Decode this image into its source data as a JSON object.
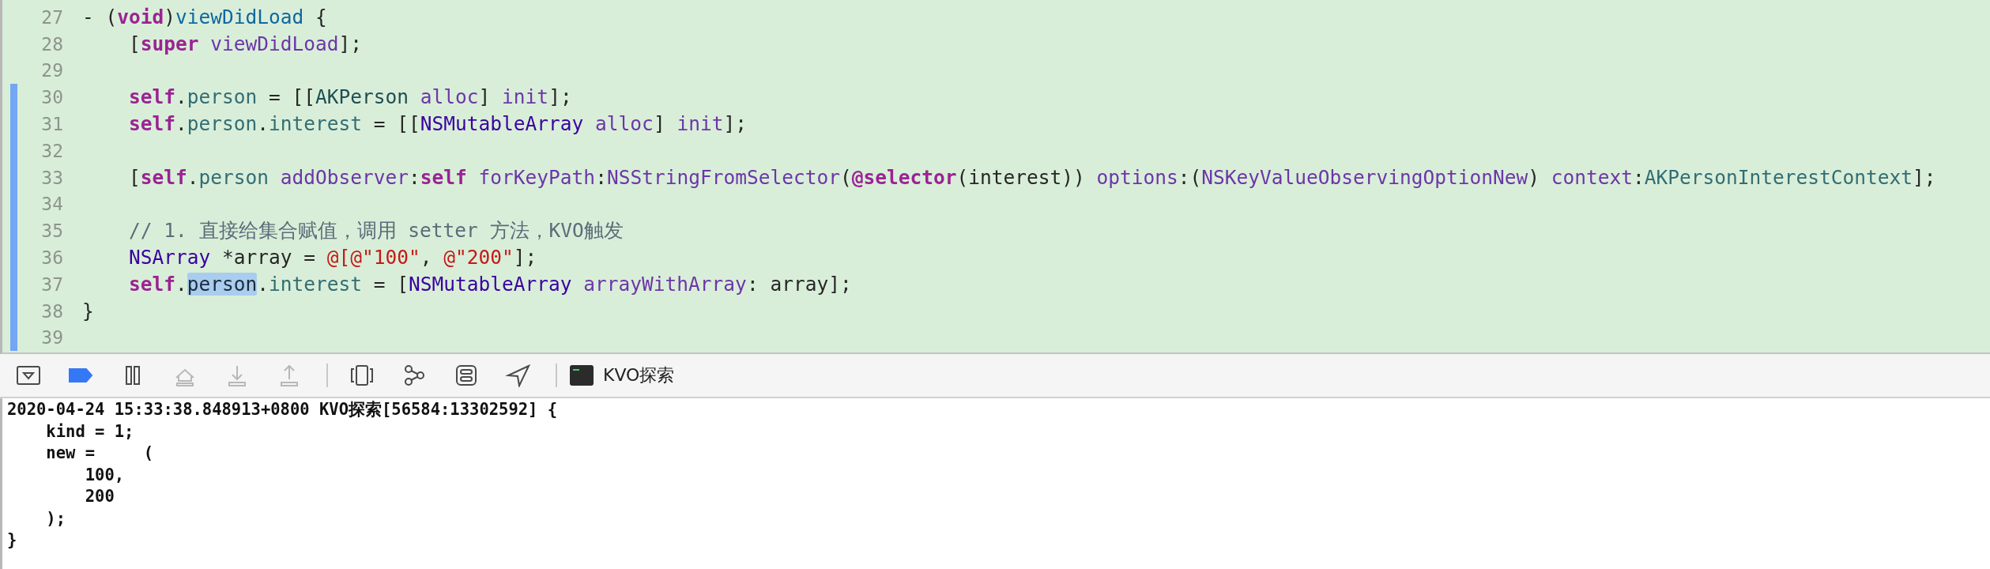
{
  "editor": {
    "lines": [
      {
        "number": "27",
        "changed": false,
        "tokens": [
          {
            "text": "- (",
            "kind": "plain"
          },
          {
            "text": "void",
            "kind": "keyword"
          },
          {
            "text": ")",
            "kind": "plain"
          },
          {
            "text": "viewDidLoad",
            "kind": "declaration"
          },
          {
            "text": " {",
            "kind": "plain"
          }
        ]
      },
      {
        "number": "28",
        "changed": false,
        "tokens": [
          {
            "text": "    [",
            "kind": "plain"
          },
          {
            "text": "super",
            "kind": "keyword"
          },
          {
            "text": " viewDidLoad",
            "kind": "method"
          },
          {
            "text": "];",
            "kind": "plain"
          }
        ]
      },
      {
        "number": "29",
        "changed": false
      },
      {
        "number": "30",
        "changed": true,
        "tokens": [
          {
            "text": "    self",
            "kind": "keyword"
          },
          {
            "text": ".",
            "kind": "plain"
          },
          {
            "text": "person",
            "kind": "property"
          },
          {
            "text": " = [[",
            "kind": "plain"
          },
          {
            "text": "AKPerson",
            "kind": "project-type"
          },
          {
            "text": " alloc",
            "kind": "method"
          },
          {
            "text": "] ",
            "kind": "plain"
          },
          {
            "text": "init",
            "kind": "method"
          },
          {
            "text": "];",
            "kind": "plain"
          }
        ]
      },
      {
        "number": "31",
        "changed": true,
        "tokens": [
          {
            "text": "    self",
            "kind": "keyword"
          },
          {
            "text": ".",
            "kind": "plain"
          },
          {
            "text": "person",
            "kind": "property"
          },
          {
            "text": ".",
            "kind": "plain"
          },
          {
            "text": "interest",
            "kind": "property"
          },
          {
            "text": " = [[",
            "kind": "plain"
          },
          {
            "text": "NSMutableArray",
            "kind": "type"
          },
          {
            "text": " alloc",
            "kind": "method"
          },
          {
            "text": "] ",
            "kind": "plain"
          },
          {
            "text": "init",
            "kind": "method"
          },
          {
            "text": "];",
            "kind": "plain"
          }
        ]
      },
      {
        "number": "32",
        "changed": true
      },
      {
        "number": "33",
        "changed": true,
        "tokens": [
          {
            "text": "    [",
            "kind": "plain"
          },
          {
            "text": "self",
            "kind": "keyword"
          },
          {
            "text": ".",
            "kind": "plain"
          },
          {
            "text": "person",
            "kind": "property"
          },
          {
            "text": " addObserver",
            "kind": "method"
          },
          {
            "text": ":",
            "kind": "plain"
          },
          {
            "text": "self",
            "kind": "keyword"
          },
          {
            "text": " forKeyPath",
            "kind": "method"
          },
          {
            "text": ":",
            "kind": "plain"
          },
          {
            "text": "NSStringFromSelector",
            "kind": "method"
          },
          {
            "text": "(",
            "kind": "plain"
          },
          {
            "text": "@selector",
            "kind": "keyword"
          },
          {
            "text": "(interest)) ",
            "kind": "plain"
          },
          {
            "text": "options",
            "kind": "method"
          },
          {
            "text": ":(",
            "kind": "plain"
          },
          {
            "text": "NSKeyValueObservingOptionNew",
            "kind": "method"
          },
          {
            "text": ") ",
            "kind": "plain"
          },
          {
            "text": "context",
            "kind": "method"
          },
          {
            "text": ":",
            "kind": "plain"
          },
          {
            "text": "AKPersonInterestContext",
            "kind": "constant"
          },
          {
            "text": "];",
            "kind": "plain"
          }
        ]
      },
      {
        "number": "34",
        "changed": true
      },
      {
        "number": "35",
        "changed": true,
        "tokens": [
          {
            "text": "    // 1. 直接给集合赋值，调用 setter 方法，KVO触发",
            "kind": "comment"
          }
        ]
      },
      {
        "number": "36",
        "changed": true,
        "tokens": [
          {
            "text": "    NSArray",
            "kind": "type"
          },
          {
            "text": " *array = ",
            "kind": "plain"
          },
          {
            "text": "@[@\"100\"",
            "kind": "string"
          },
          {
            "text": ", ",
            "kind": "plain"
          },
          {
            "text": "@\"200\"",
            "kind": "string"
          },
          {
            "text": "];",
            "kind": "plain"
          }
        ]
      },
      {
        "number": "37",
        "changed": true,
        "tokens": [
          {
            "text": "    self",
            "kind": "keyword"
          },
          {
            "text": ".",
            "kind": "plain"
          },
          {
            "text": "person",
            "kind": "selected-property"
          },
          {
            "text": ".",
            "kind": "plain"
          },
          {
            "text": "interest",
            "kind": "property"
          },
          {
            "text": " = [",
            "kind": "plain"
          },
          {
            "text": "NSMutableArray",
            "kind": "type"
          },
          {
            "text": " arrayWithArray",
            "kind": "method"
          },
          {
            "text": ": array];",
            "kind": "plain"
          }
        ]
      },
      {
        "number": "38",
        "changed": true,
        "tokens": [
          {
            "text": "}",
            "kind": "plain"
          }
        ]
      },
      {
        "number": "39",
        "changed": true
      }
    ]
  },
  "debug_bar": {
    "buttons": [
      {
        "kind": "hide-console",
        "on": false,
        "disabled": false
      },
      {
        "kind": "breakpoints",
        "on": true,
        "disabled": false
      },
      {
        "kind": "pause",
        "on": false,
        "disabled": false
      },
      {
        "kind": "step-over",
        "on": false,
        "disabled": true
      },
      {
        "kind": "step-into",
        "on": false,
        "disabled": true
      },
      {
        "kind": "step-out",
        "on": false,
        "disabled": true
      },
      {
        "kind": "view-debugger",
        "on": false,
        "disabled": false
      },
      {
        "kind": "memory-graph",
        "on": false,
        "disabled": false
      },
      {
        "kind": "environment",
        "on": false,
        "disabled": false
      },
      {
        "kind": "location",
        "on": false,
        "disabled": false
      }
    ],
    "target": "KVO探索"
  },
  "console": {
    "lines": [
      "2020-04-24 15:33:38.848913+0800 KVO探索[56584:13302592] {",
      "    kind = 1;",
      "    new =     (",
      "        100,",
      "        200",
      "    );",
      "}"
    ]
  }
}
